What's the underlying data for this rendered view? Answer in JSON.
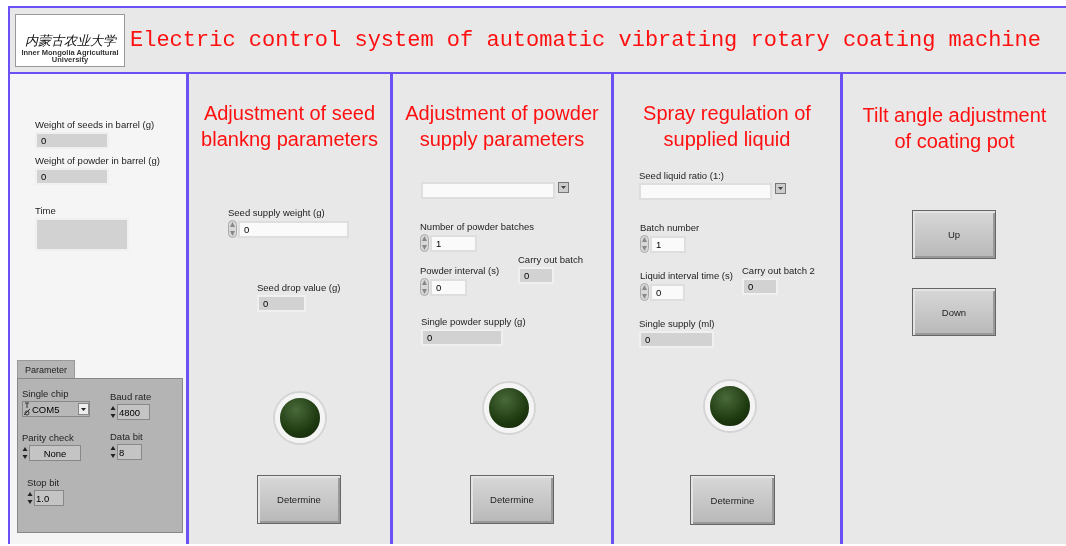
{
  "header": {
    "logo": {
      "name_chinese": "内蒙古农业大学",
      "name_english": "Inner Mongolia Agricultural University"
    },
    "title": "Electric control system of automatic vibrating rotary coating machine"
  },
  "status": {
    "items": [
      {
        "kind": "indicator",
        "label": "Weight of seeds in barrel (g)",
        "value": "0"
      },
      {
        "kind": "indicator",
        "label": "Weight of powder in barrel (g)",
        "value": "0"
      },
      {
        "kind": "indicator",
        "label": "Time"
      }
    ]
  },
  "parameter": {
    "tabs": [
      {
        "label": "Parameter",
        "selected": true
      }
    ],
    "controls": [
      {
        "kind": "combo",
        "label": "Single chip",
        "value": "COM5"
      },
      {
        "kind": "numeric",
        "label": "Baud rate",
        "value": "4800"
      },
      {
        "kind": "ring",
        "label": "Parity check",
        "value": "None"
      },
      {
        "kind": "numeric",
        "label": "Data bit",
        "value": "8"
      },
      {
        "kind": "numeric",
        "label": "Stop bit",
        "value": "1.0"
      }
    ]
  },
  "sections": [
    {
      "heading": [
        "Adjustment of seed",
        "blankng parameters"
      ],
      "controls": [
        {
          "kind": "numeric",
          "label": "Seed supply weight  (g)",
          "value": "0"
        },
        {
          "kind": "indicator",
          "label": "Seed drop value  (g)",
          "value": "0"
        },
        {
          "kind": "led",
          "on": false
        },
        {
          "kind": "button",
          "label": "Determine"
        }
      ]
    },
    {
      "heading": [
        "Adjustment of powder",
        "supply  parameters"
      ],
      "controls": [
        {
          "kind": "dropdown"
        },
        {
          "kind": "numeric",
          "label": "Number of powder batches",
          "value": "1"
        },
        {
          "kind": "numeric",
          "label": "Powder interval (s)",
          "value": "0"
        },
        {
          "kind": "indicator",
          "label": "Carry out batch",
          "value": "0"
        },
        {
          "kind": "indicator",
          "label": "Single powder supply (g)",
          "value": "0"
        },
        {
          "kind": "led",
          "on": false
        },
        {
          "kind": "button",
          "label": "Determine"
        }
      ]
    },
    {
      "heading": [
        "Spray regulation of",
        "supplied liquid"
      ],
      "controls": [
        {
          "kind": "dropdown",
          "label": "Seed liquid ratio (1:)"
        },
        {
          "kind": "numeric",
          "label": "Batch number",
          "value": "1"
        },
        {
          "kind": "numeric",
          "label": "Liquid interval time (s)",
          "value": "0"
        },
        {
          "kind": "indicator",
          "label": "Carry out batch 2",
          "value": "0"
        },
        {
          "kind": "indicator",
          "label": "Single supply (ml)",
          "value": "0"
        },
        {
          "kind": "led",
          "on": false
        },
        {
          "kind": "button",
          "label": "Determine"
        }
      ]
    },
    {
      "heading": [
        "Tilt angle adjustment",
        "of coating pot"
      ],
      "controls": [
        {
          "kind": "button",
          "label": "Up"
        },
        {
          "kind": "button",
          "label": "Down"
        }
      ]
    }
  ]
}
